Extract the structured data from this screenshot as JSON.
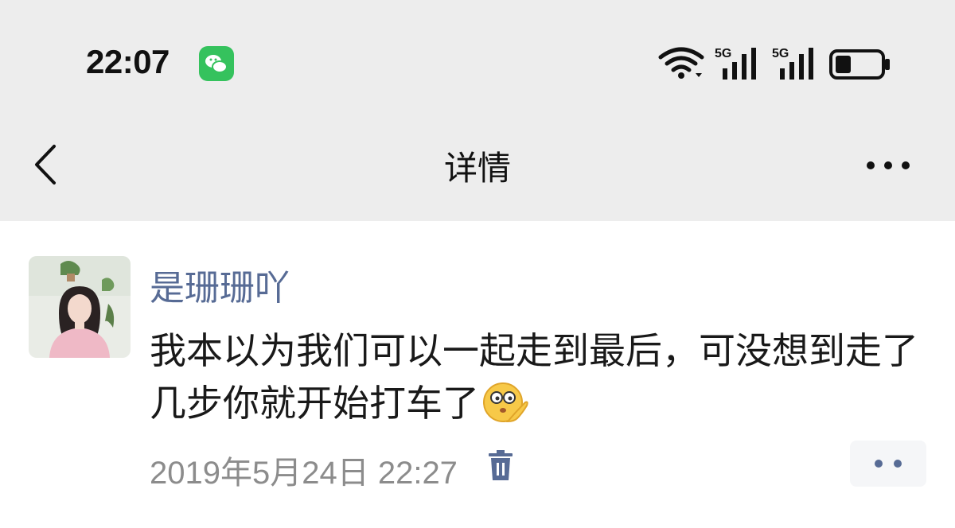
{
  "status_bar": {
    "time": "22:07",
    "icons": [
      "wechat-icon",
      "wifi-icon",
      "signal-5g-icon",
      "signal-5g-icon",
      "battery-icon"
    ],
    "network_labels": [
      "5G",
      "5G"
    ],
    "battery_level": 0.35
  },
  "nav": {
    "title": "详情",
    "back_icon": "chevron-left-icon",
    "more_icon": "more-dots-icon"
  },
  "post": {
    "username": "是珊珊吖",
    "content": "我本以为我们可以一起走到最后，可没想到走了几步你就开始打车了",
    "emoji": "thinking-face-emoji",
    "timestamp": "2019年5月24日 22:27",
    "delete_icon": "trash-icon",
    "comment_icon": "comment-dots-icon"
  },
  "colors": {
    "header_bg": "#ededed",
    "username": "#576b95",
    "wechat_green": "#35c25d",
    "timestamp": "#8c8c8c"
  }
}
